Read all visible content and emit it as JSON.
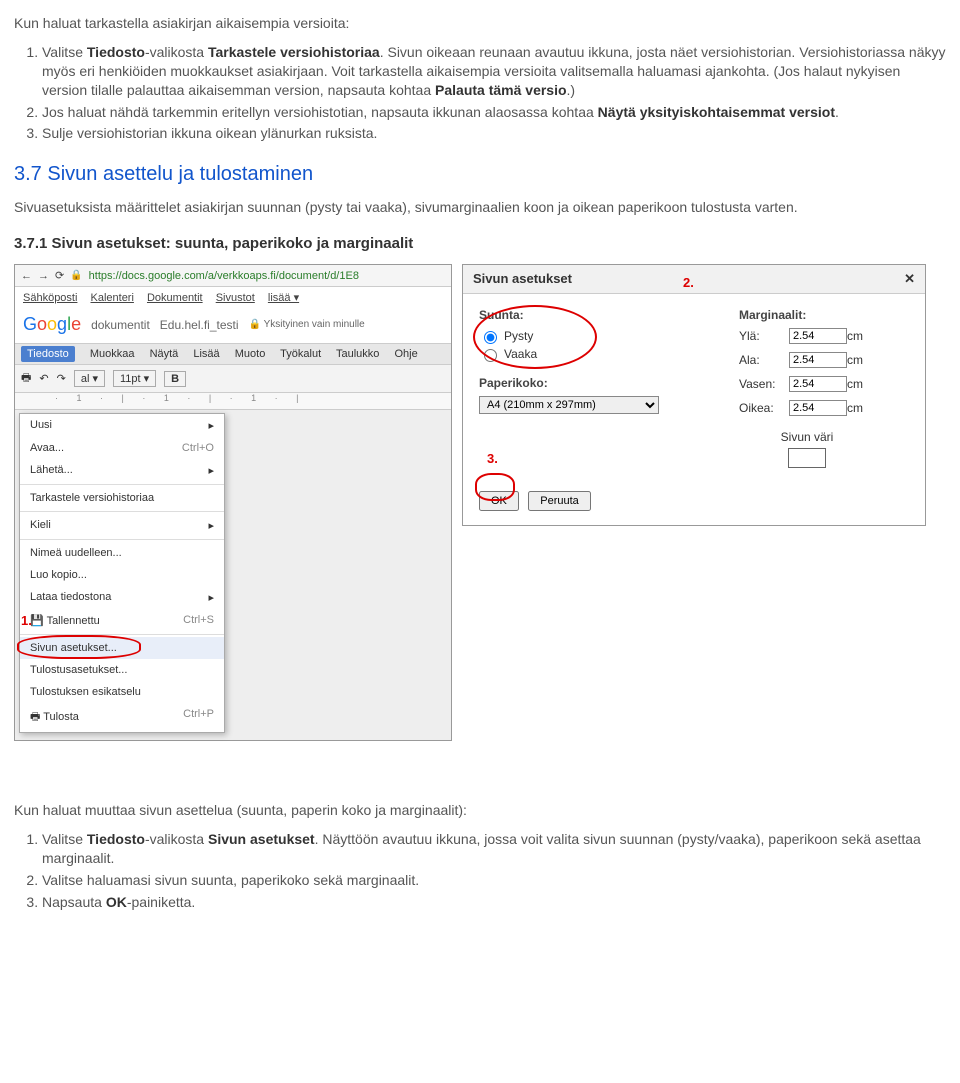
{
  "intro": "Kun haluat tarkastella asiakirjan aikaisempia versioita:",
  "steps1": {
    "s1a": "Valitse ",
    "s1b": "Tiedosto",
    "s1c": "-valikosta ",
    "s1d": "Tarkastele versiohistoriaa",
    "s1e": ". Sivun oikeaan reunaan avautuu ikkuna, josta näet versiohistorian. Versiohistoriassa näkyy myös eri henkiöiden muokkaukset asiakirjaan. Voit tarkastella aikaisempia versioita valitsemalla haluamasi ajankohta. (Jos halaut nykyisen version tilalle palauttaa aikaisemman version, napsauta kohtaa ",
    "s1f": "Palauta tämä versio",
    "s1g": ".)",
    "s2a": "Jos haluat nähdä tarkemmin eritellyn versiohistotian, napsauta ikkunan alaosassa kohtaa ",
    "s2b": "Näytä yksityiskohtaisemmat versiot",
    "s2c": ".",
    "s3": "Sulje versiohistorian ikkuna oikean ylänurkan ruksista."
  },
  "h37": "3.7 Sivun asettelu ja tulostaminen",
  "p37": "Sivuasetuksista määrittelet asiakirjan suunnan (pysty tai vaaka), sivumarginaalien koon ja oikean paperikoon tulostusta varten.",
  "h371": "3.7.1 Sivun asetukset: suunta, paperikoko ja marginaalit",
  "fig1": {
    "url": "https://docs.google.com/a/verkkoaps.fi/document/d/1E8",
    "navlinks": [
      "Sähköposti",
      "Kalenteri",
      "Dokumentit",
      "Sivustot",
      "lisää ▾"
    ],
    "doklabel": "dokumentit",
    "doctitle": "Edu.hel.fi_testi",
    "privacy": "Yksityinen vain minulle",
    "menus": [
      "Tiedosto",
      "Muokkaa",
      "Näytä",
      "Lisää",
      "Muoto",
      "Työkalut",
      "Taulukko",
      "Ohje"
    ],
    "toolbar": {
      "style": "al",
      "size": "11pt",
      "bold": "B"
    },
    "dropdown": [
      {
        "label": "Uusi",
        "sc": ""
      },
      {
        "label": "Avaa...",
        "sc": "Ctrl+O"
      },
      {
        "label": "Lähetä...",
        "sc": ""
      },
      {
        "sep": true
      },
      {
        "label": "Tarkastele versiohistoriaa",
        "sc": ""
      },
      {
        "sep": true
      },
      {
        "label": "Kieli",
        "sc": ""
      },
      {
        "sep": true
      },
      {
        "label": "Nimeä uudelleen...",
        "sc": ""
      },
      {
        "label": "Luo kopio...",
        "sc": ""
      },
      {
        "label": "Lataa tiedostona",
        "sc": ""
      },
      {
        "label": "Tallennettu",
        "sc": "Ctrl+S",
        "icon": "save"
      },
      {
        "sep": true
      },
      {
        "label": "Sivun asetukset...",
        "sc": "",
        "hover": true
      },
      {
        "label": "Tulostusasetukset...",
        "sc": ""
      },
      {
        "label": "Tulostuksen esikatselu",
        "sc": ""
      },
      {
        "label": "Tulosta",
        "sc": "Ctrl+P",
        "icon": "print"
      }
    ],
    "annot1": "1."
  },
  "fig2": {
    "title": "Sivun asetukset",
    "suunta": "Suunta:",
    "pysty": "Pysty",
    "vaaka": "Vaaka",
    "paperikoko": "Paperikoko:",
    "paperval": "A4 (210mm x 297mm)",
    "marg": "Marginaalit:",
    "rows": [
      {
        "l": "Ylä:",
        "v": "2.54"
      },
      {
        "l": "Ala:",
        "v": "2.54"
      },
      {
        "l": "Vasen:",
        "v": "2.54"
      },
      {
        "l": "Oikea:",
        "v": "2.54"
      }
    ],
    "cm": "cm",
    "sivunvari": "Sivun väri",
    "ok": "OK",
    "peruuta": "Peruuta",
    "annot2": "2.",
    "annot3": "3."
  },
  "closing_intro": "Kun haluat muuttaa sivun asettelua (suunta, paperin koko ja marginaalit):",
  "steps2": {
    "s1a": "Valitse ",
    "s1b": "Tiedosto",
    "s1c": "-valikosta ",
    "s1d": "Sivun asetukset",
    "s1e": ". Näyttöön avautuu ikkuna, jossa voit valita sivun suunnan (pysty/vaaka), paperikoon sekä asettaa marginaalit.",
    "s2": "Valitse haluamasi sivun suunta, paperikoko sekä marginaalit.",
    "s3a": "Napsauta ",
    "s3b": "OK",
    "s3c": "-painiketta."
  }
}
